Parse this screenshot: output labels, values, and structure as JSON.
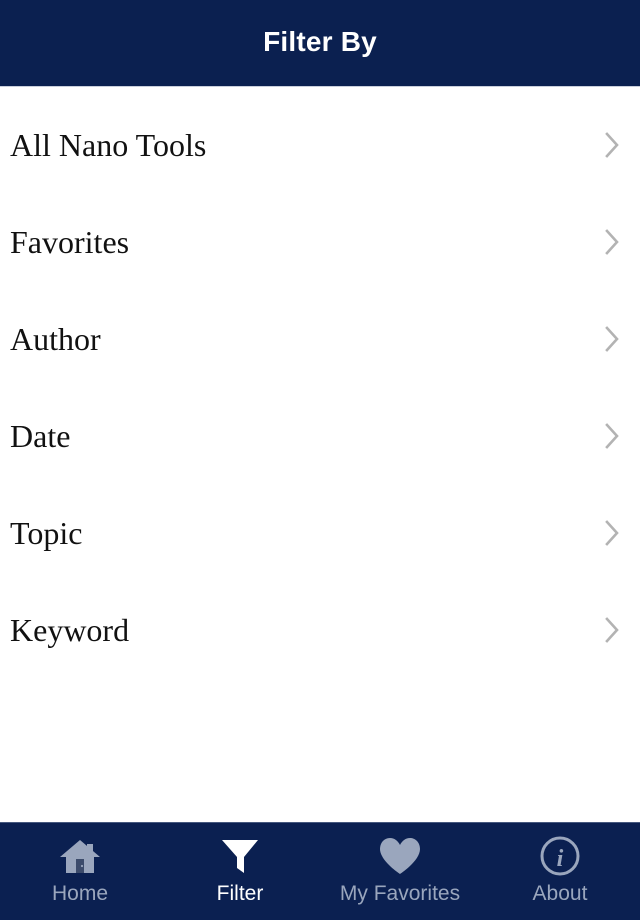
{
  "header": {
    "title": "Filter By",
    "background_color": "#0b2050",
    "text_color": "#ffffff"
  },
  "filter_list": {
    "items": [
      {
        "label": "All Nano Tools",
        "chevron_icon": "chevron-right-icon"
      },
      {
        "label": "Favorites",
        "chevron_icon": "chevron-right-icon"
      },
      {
        "label": "Author",
        "chevron_icon": "chevron-right-icon"
      },
      {
        "label": "Date",
        "chevron_icon": "chevron-right-icon"
      },
      {
        "label": "Topic",
        "chevron_icon": "chevron-right-icon"
      },
      {
        "label": "Keyword",
        "chevron_icon": "chevron-right-icon"
      }
    ],
    "chevron_color": "#b3b3b3",
    "text_color": "#111111",
    "background_color": "#ffffff"
  },
  "tabbar": {
    "background_color": "#0b2051",
    "active_color": "#ffffff",
    "inactive_color": "#9aa6bd",
    "icon_inactive_color": "#9aa6bd",
    "tabs": [
      {
        "label": "Home",
        "icon": "home-icon",
        "active": false
      },
      {
        "label": "Filter",
        "icon": "funnel-icon",
        "active": true
      },
      {
        "label": "My Favorites",
        "icon": "heart-icon",
        "active": false
      },
      {
        "label": "About",
        "icon": "info-circle-icon",
        "active": false
      }
    ]
  }
}
